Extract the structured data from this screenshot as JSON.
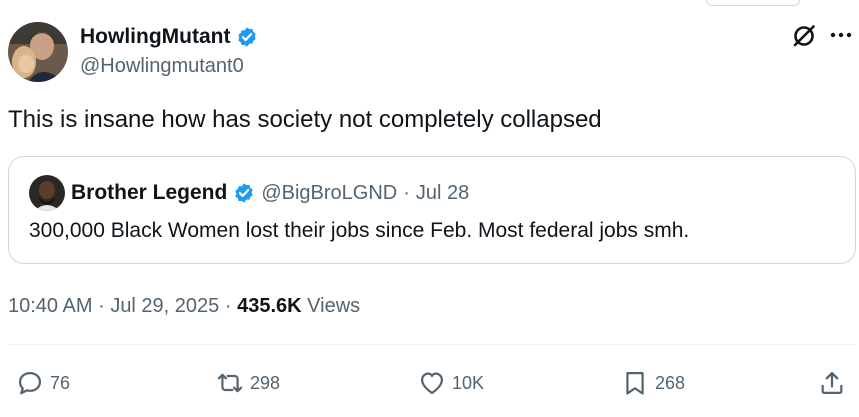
{
  "author": {
    "display_name": "HowlingMutant",
    "handle": "@Howlingmutant0",
    "verified": true
  },
  "tweet": {
    "text": "This is insane how has society not completely collapsed"
  },
  "quoted_tweet": {
    "display_name": "Brother Legend",
    "handle": "@BigBroLGND",
    "separator": "·",
    "date": "Jul 28",
    "text": "300,000 Black Women lost their jobs since Feb. Most federal jobs smh."
  },
  "meta": {
    "time": "10:40 AM",
    "separator": "·",
    "date": "Jul 29, 2025",
    "views_count": "435.6K",
    "views_label": "Views"
  },
  "actions": {
    "replies": "76",
    "reposts": "298",
    "likes": "10K",
    "bookmarks": "268"
  },
  "colors": {
    "verified_blue": "#1d9bf0",
    "secondary_text": "#536471",
    "primary_text": "#0f1419",
    "border": "#cfd9de"
  },
  "icons": {
    "grok": "grok-icon",
    "more": "more-icon",
    "reply": "reply-icon",
    "repost": "repost-icon",
    "like": "heart-icon",
    "bookmark": "bookmark-icon",
    "share": "share-icon"
  }
}
